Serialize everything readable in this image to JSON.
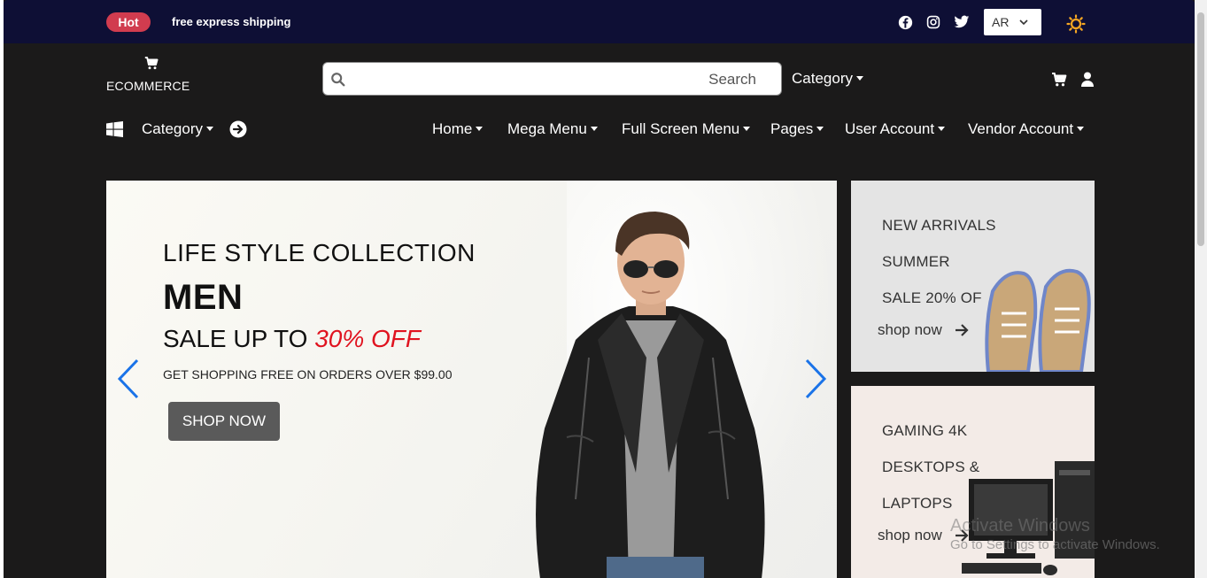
{
  "topbar": {
    "badge": "Hot",
    "shipping": "free express shipping",
    "language": "AR",
    "social_icons": [
      "facebook-icon",
      "instagram-icon",
      "twitter-icon"
    ]
  },
  "header": {
    "logo_text": "ECOMMERCE",
    "search_label": "Search",
    "category": "Category"
  },
  "nav": {
    "category": "Category",
    "items": [
      "Home",
      "Mega Menu",
      "Full Screen Menu",
      "Pages",
      "User Account",
      "Vendor Account"
    ]
  },
  "hero": {
    "line1": "LIFE STYLE COLLECTION",
    "line2": "MEN",
    "line3_prefix": "SALE UP TO ",
    "line3_highlight": "30% OFF",
    "line4": "GET SHOPPING FREE ON ORDERS OVER $99.00",
    "button": "SHOP NOW"
  },
  "side_banners": [
    {
      "lines": [
        "NEW ARRIVALS",
        "SUMMER",
        "SALE 20% OF"
      ],
      "link": "shop now"
    },
    {
      "lines": [
        "GAMING 4K",
        "DESKTOPS &",
        "LAPTOPS"
      ],
      "link": "shop now"
    }
  ],
  "watermark": {
    "title": "Activate Windows",
    "subtitle": "Go to Settings to activate Windows."
  },
  "colors": {
    "topbar": "#0e0f35",
    "header": "#1b1a1a",
    "hot_badge": "#d13c4f",
    "highlight": "#e0131f",
    "carousel_arrow": "#1a73e8",
    "sun": "#f5a623"
  }
}
